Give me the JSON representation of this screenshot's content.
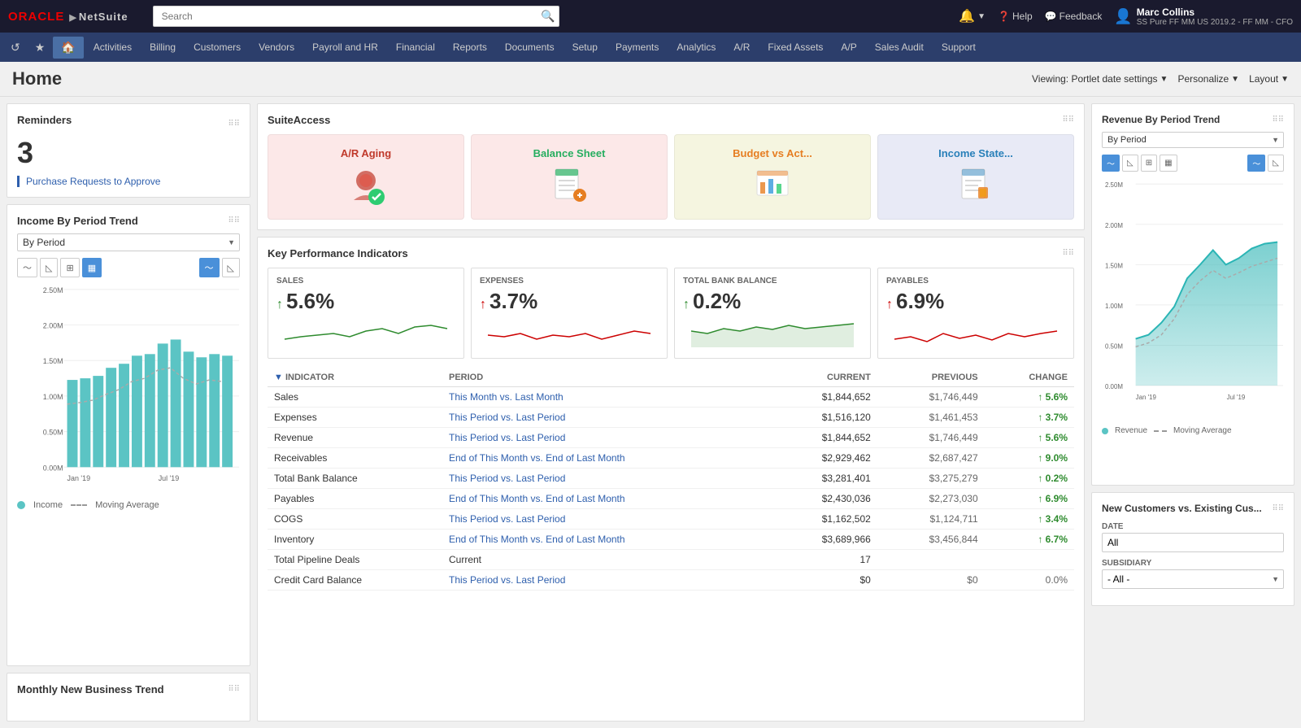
{
  "topbar": {
    "logo_oracle": "ORACLE",
    "logo_netsuite": "NetSuite",
    "search_placeholder": "Search",
    "help_label": "Help",
    "feedback_label": "Feedback",
    "user_name": "Marc Collins",
    "user_subtitle": "SS Pure FF MM US 2019.2 - FF MM - CFO"
  },
  "navbar": {
    "items": [
      {
        "id": "activities",
        "label": "Activities"
      },
      {
        "id": "billing",
        "label": "Billing"
      },
      {
        "id": "customers",
        "label": "Customers"
      },
      {
        "id": "vendors",
        "label": "Vendors"
      },
      {
        "id": "payroll",
        "label": "Payroll and HR"
      },
      {
        "id": "financial",
        "label": "Financial"
      },
      {
        "id": "reports",
        "label": "Reports"
      },
      {
        "id": "documents",
        "label": "Documents"
      },
      {
        "id": "setup",
        "label": "Setup"
      },
      {
        "id": "payments",
        "label": "Payments"
      },
      {
        "id": "analytics",
        "label": "Analytics"
      },
      {
        "id": "ar",
        "label": "A/R"
      },
      {
        "id": "fixed-assets",
        "label": "Fixed Assets"
      },
      {
        "id": "ap",
        "label": "A/P"
      },
      {
        "id": "sales-audit",
        "label": "Sales Audit"
      },
      {
        "id": "support",
        "label": "Support"
      }
    ]
  },
  "page_header": {
    "title": "Home",
    "viewing_label": "Viewing: Portlet date settings",
    "personalize_label": "Personalize",
    "layout_label": "Layout"
  },
  "reminders": {
    "title": "Reminders",
    "count": "3",
    "link_text": "Purchase Requests to Approve"
  },
  "income_trend": {
    "title": "Income By Period Trend",
    "period_option": "By Period",
    "legend_income": "Income",
    "legend_moving_avg": "Moving Average",
    "y_labels": [
      "2.50M",
      "2.00M",
      "1.50M",
      "1.00M",
      "0.50M",
      "0.00M"
    ],
    "x_labels": [
      "Jan '19",
      "Jul '19"
    ]
  },
  "monthly_new_business": {
    "title": "Monthly New Business Trend"
  },
  "suite_access": {
    "title": "SuiteAccess",
    "items": [
      {
        "id": "ar-aging",
        "label": "A/R Aging",
        "bg": "#fce8e8",
        "icon_color": "#c0392b"
      },
      {
        "id": "balance-sheet",
        "label": "Balance Sheet",
        "bg": "#fce8e8",
        "icon_color": "#27ae60"
      },
      {
        "id": "budget-vs-act",
        "label": "Budget vs Act...",
        "bg": "#f5f5e0",
        "icon_color": "#e67e22"
      },
      {
        "id": "income-state",
        "label": "Income State...",
        "bg": "#e8eaf6",
        "icon_color": "#2980b9"
      }
    ]
  },
  "kpi": {
    "title": "Key Performance Indicators",
    "cards": [
      {
        "id": "sales",
        "label": "SALES",
        "value": "5.6%",
        "direction": "up"
      },
      {
        "id": "expenses",
        "label": "EXPENSES",
        "value": "3.7%",
        "direction": "up"
      },
      {
        "id": "total-bank",
        "label": "TOTAL BANK BALANCE",
        "value": "0.2%",
        "direction": "up"
      },
      {
        "id": "payables",
        "label": "PAYABLES",
        "value": "6.9%",
        "direction": "up"
      }
    ],
    "table": {
      "headers": [
        "INDICATOR",
        "PERIOD",
        "CURRENT",
        "PREVIOUS",
        "CHANGE"
      ],
      "rows": [
        {
          "indicator": "Sales",
          "period": "This Month vs. Last Month",
          "current": "$1,844,652",
          "previous": "$1,746,449",
          "change": "↑ 5.6%",
          "direction": "positive"
        },
        {
          "indicator": "Expenses",
          "period": "This Period vs. Last Period",
          "current": "$1,516,120",
          "previous": "$1,461,453",
          "change": "↑ 3.7%",
          "direction": "positive"
        },
        {
          "indicator": "Revenue",
          "period": "This Period vs. Last Period",
          "current": "$1,844,652",
          "previous": "$1,746,449",
          "change": "↑ 5.6%",
          "direction": "positive"
        },
        {
          "indicator": "Receivables",
          "period": "End of This Month vs. End of Last Month",
          "current": "$2,929,462",
          "previous": "$2,687,427",
          "change": "↑ 9.0%",
          "direction": "positive"
        },
        {
          "indicator": "Total Bank Balance",
          "period": "This Period vs. Last Period",
          "current": "$3,281,401",
          "previous": "$3,275,279",
          "change": "↑ 0.2%",
          "direction": "positive"
        },
        {
          "indicator": "Payables",
          "period": "End of This Month vs. End of Last Month",
          "current": "$2,430,036",
          "previous": "$2,273,030",
          "change": "↑ 6.9%",
          "direction": "positive"
        },
        {
          "indicator": "COGS",
          "period": "This Period vs. Last Period",
          "current": "$1,162,502",
          "previous": "$1,124,711",
          "change": "↑ 3.4%",
          "direction": "positive"
        },
        {
          "indicator": "Inventory",
          "period": "End of This Month vs. End of Last Month",
          "current": "$3,689,966",
          "previous": "$3,456,844",
          "change": "↑ 6.7%",
          "direction": "positive"
        },
        {
          "indicator": "Total Pipeline Deals",
          "period": "Current",
          "current": "17",
          "previous": "",
          "change": "",
          "direction": "neutral"
        },
        {
          "indicator": "Credit Card Balance",
          "period": "This Period vs. Last Period",
          "current": "$0",
          "previous": "$0",
          "change": "0.0%",
          "direction": "neutral"
        }
      ]
    }
  },
  "revenue_trend": {
    "title": "Revenue By Period Trend",
    "period_option": "By Period",
    "legend_revenue": "Revenue",
    "legend_moving_avg": "Moving Average",
    "y_labels": [
      "2.50M",
      "2.00M",
      "1.50M",
      "1.00M",
      "0.50M",
      "0.00M"
    ],
    "x_labels": [
      "Jan '19",
      "Jul '19"
    ]
  },
  "new_customers": {
    "title": "New Customers vs. Existing Cus...",
    "date_label": "DATE",
    "date_value": "All",
    "subsidiary_label": "SUBSIDIARY",
    "subsidiary_value": "- All -"
  }
}
